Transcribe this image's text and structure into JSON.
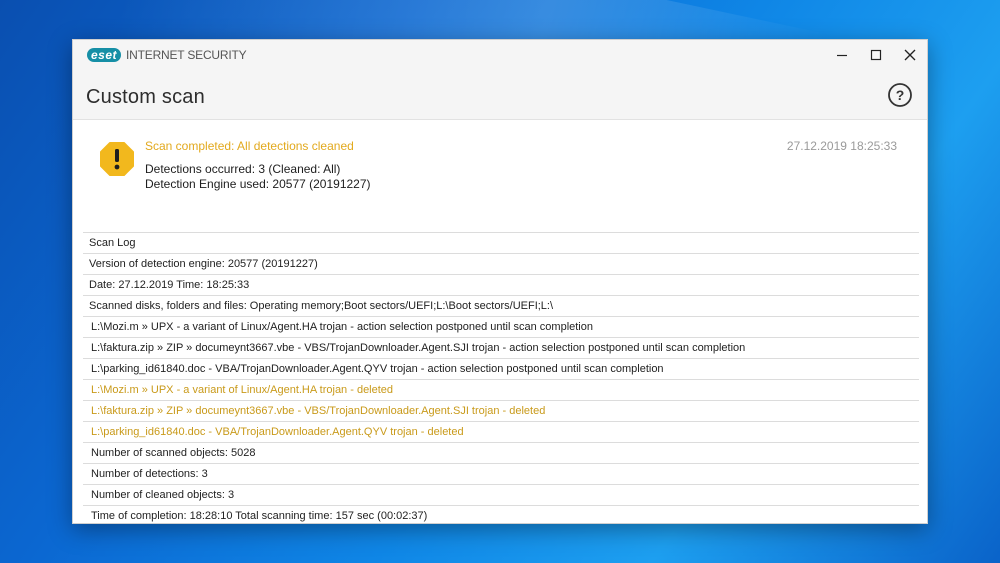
{
  "window": {
    "brand_logo": "eset",
    "product_name": "INTERNET SECURITY",
    "controls": [
      "minimize-icon",
      "maximize-icon",
      "close-icon"
    ]
  },
  "header": {
    "title": "Custom scan",
    "help_icon": "help-circle-icon"
  },
  "summary": {
    "icon": "warning-icon",
    "status": "Scan completed: All detections cleaned",
    "timestamp": "27.12.2019 18:25:33",
    "detections_line": "Detections occurred: 3 (Cleaned: All)",
    "engine_line": "Detection Engine used: 20577 (20191227)"
  },
  "log": {
    "rows": [
      {
        "text": "Scan Log",
        "kind": "normal"
      },
      {
        "text": "Version of detection engine: 20577 (20191227)",
        "kind": "normal"
      },
      {
        "text": "Date: 27.12.2019  Time: 18:25:33",
        "kind": "normal"
      },
      {
        "text": "Scanned disks, folders and files: Operating memory;Boot sectors/UEFI;L:\\Boot sectors/UEFI;L:\\",
        "kind": "normal"
      },
      {
        "text": "L:\\Mozi.m » UPX - a variant of Linux/Agent.HA trojan - action selection postponed until scan completion",
        "kind": "normal"
      },
      {
        "text": "L:\\faktura.zip » ZIP » documeynt3667.vbe - VBS/TrojanDownloader.Agent.SJI trojan - action selection postponed until scan completion",
        "kind": "normal"
      },
      {
        "text": "L:\\parking_id61840.doc - VBA/TrojanDownloader.Agent.QYV trojan - action selection postponed until scan completion",
        "kind": "normal"
      },
      {
        "text": "L:\\Mozi.m » UPX - a variant of Linux/Agent.HA trojan - deleted",
        "kind": "deleted"
      },
      {
        "text": "L:\\faktura.zip » ZIP » documeynt3667.vbe - VBS/TrojanDownloader.Agent.SJI trojan - deleted",
        "kind": "deleted"
      },
      {
        "text": "L:\\parking_id61840.doc - VBA/TrojanDownloader.Agent.QYV trojan - deleted",
        "kind": "deleted"
      },
      {
        "text": "Number of scanned objects: 5028",
        "kind": "normal"
      },
      {
        "text": "Number of detections: 3",
        "kind": "normal"
      },
      {
        "text": "Number of cleaned objects: 3",
        "kind": "normal"
      },
      {
        "text": "Time of completion: 18:28:10  Total scanning time: 157 sec (00:02:37)",
        "kind": "normal"
      }
    ]
  },
  "colors": {
    "accent_warning": "#e2a91d",
    "deleted_text": "#c99a1a",
    "eset_teal": "#168fa6"
  }
}
